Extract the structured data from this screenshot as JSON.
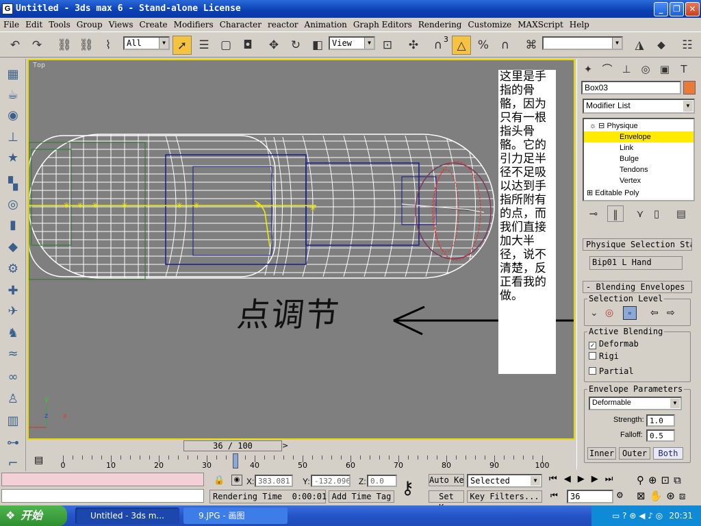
{
  "window": {
    "title": "Untitled - 3ds max 6 - Stand-alone License",
    "app_icon": "G"
  },
  "menu": [
    "File",
    "Edit",
    "Tools",
    "Group",
    "Views",
    "Create",
    "Modifiers",
    "Character",
    "reactor",
    "Animation",
    "Graph Editors",
    "Rendering",
    "Customize",
    "MAXScript",
    "Help"
  ],
  "toolbar": {
    "selection_filter": "All",
    "reference_coord": "View",
    "snap_value": "3"
  },
  "viewport": {
    "label": "Top",
    "note_text": "这里是手指的骨骼，因为只有一根指头骨骼。它的引力足半径不足吸以达到手指所附有的点，而我们直接加大半径，说不清楚，反正看我的做。",
    "handwriting": "点调节",
    "axis_x": "x",
    "axis_y": "y",
    "axis_z": "z"
  },
  "command_panel": {
    "object_name": "Box03",
    "object_color": "#e97a3a",
    "modifier_list": "Modifier List",
    "stack": [
      {
        "label": "Physique",
        "indent": 1,
        "selected": false
      },
      {
        "label": "Envelope",
        "indent": 2,
        "selected": true
      },
      {
        "label": "Link",
        "indent": 2,
        "selected": false
      },
      {
        "label": "Bulge",
        "indent": 2,
        "selected": false
      },
      {
        "label": "Tendons",
        "indent": 2,
        "selected": false
      },
      {
        "label": "Vertex",
        "indent": 2,
        "selected": false
      },
      {
        "label": "Editable Poly",
        "indent": 0,
        "selected": false
      }
    ],
    "rollout_selection_status": "Physique Selection Status",
    "selected_bone": "Bip01 L Hand",
    "rollout_blending": "- Blending Envelopes",
    "selection_level_label": "Selection Level",
    "active_blending_label": "Active Blending",
    "deformable_check": "Deformab",
    "rigid_check": "Rigi",
    "partial_check": "Partial",
    "envelope_params_label": "Envelope Parameters",
    "envelope_type": "Deformable",
    "strength_label": "Strength:",
    "strength_value": "1.0",
    "falloff_label": "Falloff:",
    "falloff_value": "0.5",
    "inner_btn": "Inner",
    "outer_btn": "Outer",
    "both_btn": "Both"
  },
  "timeline": {
    "frame_display": "36 / 100",
    "current": 36,
    "max": 100,
    "labels": [
      "0",
      "10",
      "20",
      "30",
      "40",
      "50",
      "60",
      "70",
      "80",
      "90",
      "100"
    ]
  },
  "status": {
    "x_label": "X:",
    "x_value": "383.081",
    "y_label": "Y:",
    "y_value": "-132.096",
    "z_label": "Z:",
    "z_value": "0.0",
    "auto_key": "Auto Key",
    "set_key": "Set Key",
    "key_mode": "Selected",
    "key_filters": "Key Filters...",
    "rendering_time_label": "Rendering Time",
    "rendering_time": "0:00:01",
    "add_time_tag": "Add Time Tag",
    "frame_field": "36"
  },
  "taskbar": {
    "start": "开始",
    "tasks": [
      "Untitled - 3ds m...",
      "9.JPG - 画图"
    ],
    "clock": "20:31"
  }
}
